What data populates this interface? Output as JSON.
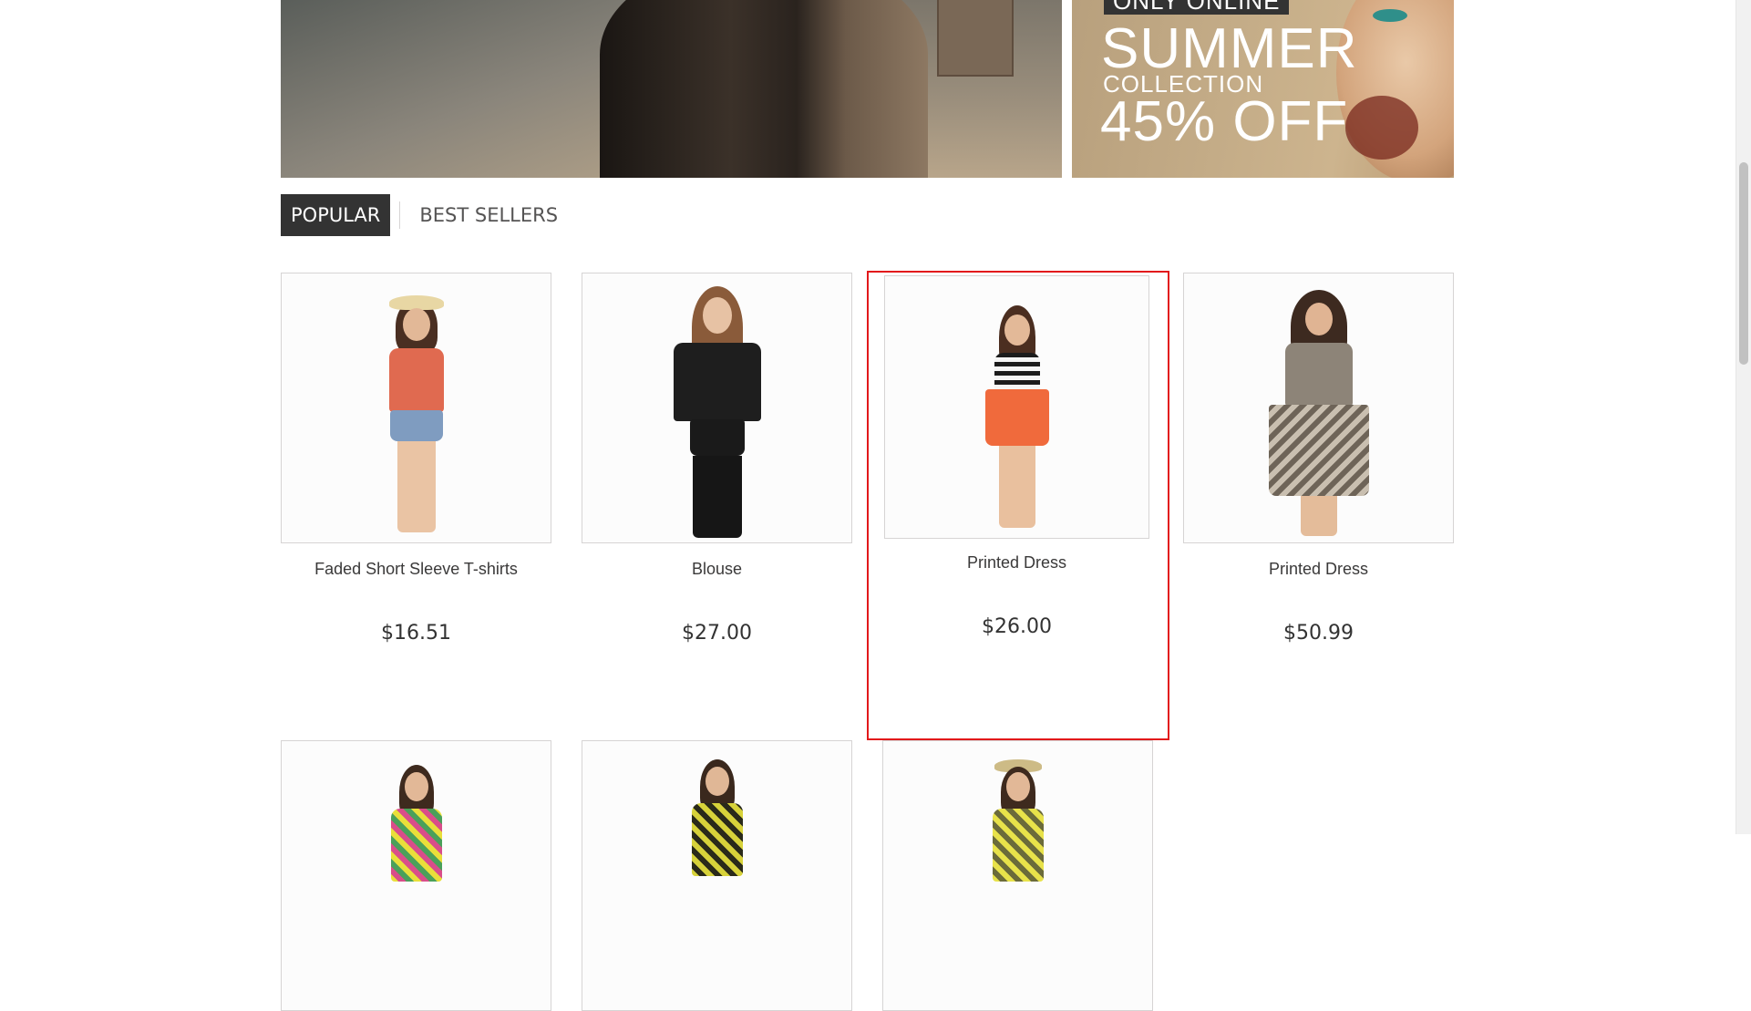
{
  "slider": {
    "prev_icon": "chevron-left-icon",
    "next_icon": "chevron-right-icon"
  },
  "promo": {
    "badge": "ONLY ONLINE",
    "headline": "SUMMER",
    "subline": "COLLECTION",
    "discount": "45% OFF"
  },
  "tabs": [
    {
      "label": "POPULAR",
      "active": true
    },
    {
      "label": "BEST SELLERS",
      "active": false
    }
  ],
  "products": [
    {
      "name": "Faded Short Sleeve T-shirts",
      "price": "$16.51"
    },
    {
      "name": "Blouse",
      "price": "$27.00"
    },
    {
      "name": "Printed Dress",
      "price": "$26.00",
      "hovered": true
    },
    {
      "name": "Printed Dress",
      "price": "$50.99"
    }
  ],
  "colors": {
    "accent_active_tab": "#333333",
    "hover_outline": "#e2191b",
    "border": "#d6d4d4"
  }
}
